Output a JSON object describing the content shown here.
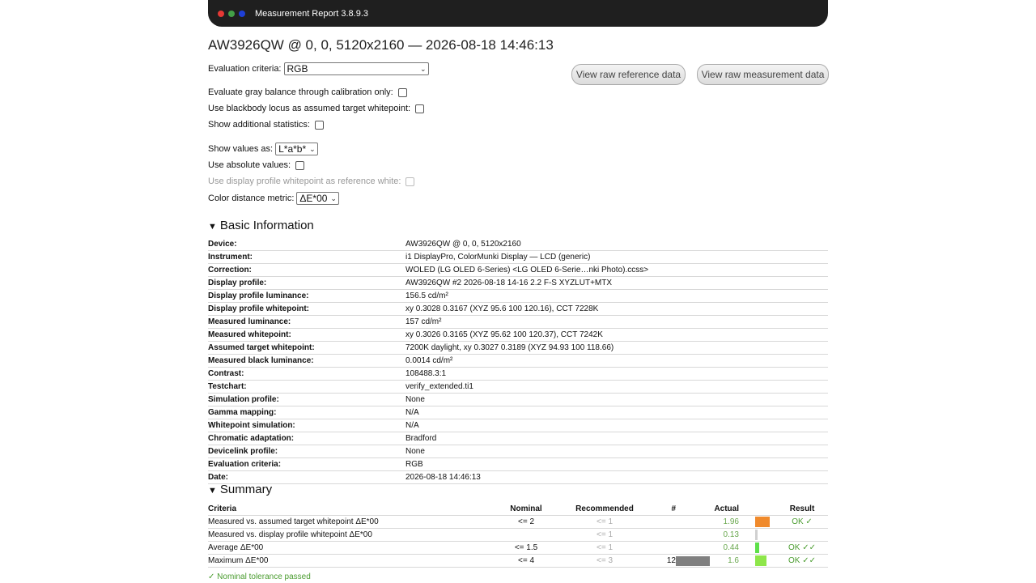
{
  "window": {
    "title": "Measurement Report 3.8.9.3",
    "dot_colors": [
      "#e53935",
      "#43a047",
      "#1e3fd6"
    ]
  },
  "report": {
    "title": "AW3926QW @ 0, 0, 5120x2160 — 2026-08-18 14:46:13"
  },
  "options": {
    "evaluation_criteria_label": "Evaluation criteria:",
    "evaluation_criteria_value": "RGB",
    "gray_balance_label": "Evaluate gray balance through calibration only:",
    "blackbody_label": "Use blackbody locus as assumed target whitepoint:",
    "additional_stats_label": "Show additional statistics:",
    "show_values_label": "Show values as:",
    "show_values_value": "L*a*b*",
    "absolute_label": "Use absolute values:",
    "profile_whitepoint_label": "Use display profile whitepoint as reference white:",
    "distance_metric_label": "Color distance metric:",
    "distance_metric_value": "ΔE*00"
  },
  "buttons": {
    "raw_reference": "View raw reference data",
    "raw_measurement": "View raw measurement data"
  },
  "basic_info": {
    "heading": "Basic Information",
    "rows": [
      {
        "key": "Device:",
        "value": "AW3926QW @ 0, 0, 5120x2160"
      },
      {
        "key": "Instrument:",
        "value": "i1 DisplayPro, ColorMunki Display — LCD (generic)"
      },
      {
        "key": "Correction:",
        "value": "WOLED (LG OLED 6-Series) <LG OLED 6-Serie…nki Photo).ccss>"
      },
      {
        "key": "Display profile:",
        "value": "AW3926QW #2 2026-08-18 14-16 2.2 F-S XYZLUT+MTX"
      },
      {
        "key": "Display profile luminance:",
        "value": "156.5 cd/m²"
      },
      {
        "key": "Display profile whitepoint:",
        "value": "xy 0.3028 0.3167 (XYZ 95.6 100 120.16), CCT 7228K"
      },
      {
        "key": "Measured luminance:",
        "value": "157 cd/m²"
      },
      {
        "key": "Measured whitepoint:",
        "value": "xy 0.3026 0.3165 (XYZ 95.62 100 120.37), CCT 7242K"
      },
      {
        "key": "Assumed target whitepoint:",
        "value": "7200K daylight, xy 0.3027 0.3189 (XYZ 94.93 100 118.66)"
      },
      {
        "key": "Measured black luminance:",
        "value": "0.0014 cd/m²"
      },
      {
        "key": "Contrast:",
        "value": "108488.3:1"
      },
      {
        "key": "Testchart:",
        "value": "verify_extended.ti1"
      },
      {
        "key": "Simulation profile:",
        "value": "None"
      },
      {
        "key": "Gamma mapping:",
        "value": "N/A"
      },
      {
        "key": "Whitepoint simulation:",
        "value": "N/A"
      },
      {
        "key": "Chromatic adaptation:",
        "value": "Bradford"
      },
      {
        "key": "Devicelink profile:",
        "value": "None"
      },
      {
        "key": "Evaluation criteria:",
        "value": "RGB"
      },
      {
        "key": "Date:",
        "value": "2026-08-18 14:46:13"
      }
    ]
  },
  "summary": {
    "heading": "Summary",
    "columns": {
      "criteria": "Criteria",
      "nominal": "Nominal",
      "recommended": "Recommended",
      "count": "#",
      "actual": "Actual",
      "result": "Result"
    },
    "rows": [
      {
        "criteria": "Measured vs. assumed target whitepoint ΔE*00",
        "nominal": "<= 2",
        "recommended": "<= 1",
        "count": "",
        "count_fraction": 0,
        "actual": "1.96",
        "swatch_color": "#f08a2c",
        "result": "OK ✓"
      },
      {
        "criteria": "Measured vs. display profile whitepoint ΔE*00",
        "nominal": "",
        "recommended": "<= 1",
        "count": "",
        "count_fraction": 0,
        "actual": "0.13",
        "swatch_color": "#d0d0d0",
        "result": ""
      },
      {
        "criteria": "Average ΔE*00",
        "nominal": "<= 1.5",
        "recommended": "<= 1",
        "count": "",
        "count_fraction": 0,
        "actual": "0.44",
        "swatch_color": "#5ee04a",
        "result": "OK ✓✓"
      },
      {
        "criteria": "Maximum ΔE*00",
        "nominal": "<= 4",
        "recommended": "<= 3",
        "count": "12",
        "count_fraction": 0.75,
        "actual": "1.6",
        "swatch_color": "#8ee64a",
        "result": "OK ✓✓"
      }
    ],
    "swatch_fractions": [
      0.6,
      0.1,
      0.15,
      0.45
    ],
    "passed_text": "✓ Nominal tolerance passed"
  }
}
